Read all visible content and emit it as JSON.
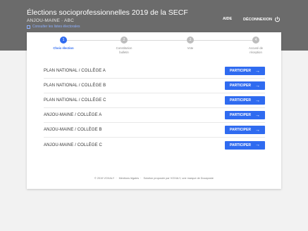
{
  "header": {
    "title": "Élections socioprofessionnelles 2019 de la SECF",
    "subtitle": "ANJOU-MAINE · ABC",
    "link_label": "Consulter les listes électorales",
    "aide": "AIDE",
    "logout": "DÉCONNEXION"
  },
  "steps": [
    {
      "number": "1",
      "label": "Choix élection",
      "active": true
    },
    {
      "number": "2",
      "label": "Constitution bulletin",
      "active": false
    },
    {
      "number": "3",
      "label": "Vote",
      "active": false
    },
    {
      "number": "4",
      "label": "Accusé de réception",
      "active": false
    }
  ],
  "elections": [
    {
      "name": "PLAN NATIONAL / COLLÈGE A",
      "button": "PARTICIPER"
    },
    {
      "name": "PLAN NATIONAL / COLLÈGE B",
      "button": "PARTICIPER"
    },
    {
      "name": "PLAN NATIONAL / COLLÈGE C",
      "button": "PARTICIPER"
    },
    {
      "name": "ANJOU-MAINE / COLLÈGE A",
      "button": "PARTICIPER"
    },
    {
      "name": "ANJOU-MAINE / COLLÈGE B",
      "button": "PARTICIPER"
    },
    {
      "name": "ANJOU-MAINE / COLLÈGE C",
      "button": "PARTICIPER"
    }
  ],
  "footer": {
    "copyright": "© 2019 VOXALY",
    "legal": "Mentions légales",
    "credit": "Solution proposée par VOXALY, une marque de Docaposte"
  },
  "colors": {
    "header_bg": "#6b6b6b",
    "accent": "#2f6bf0",
    "page_bg": "#f2f2f2"
  },
  "icons": {
    "logout": "power-icon",
    "button": "arrow-right-icon",
    "link": "document-icon"
  }
}
